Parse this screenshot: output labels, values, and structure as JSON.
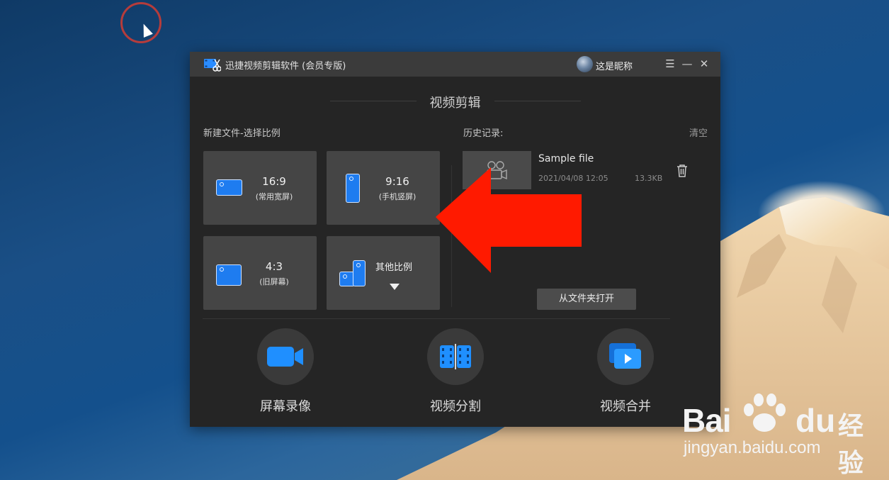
{
  "window": {
    "title": "迅捷视频剪辑软件 (会员专版)",
    "nickname": "这是昵称",
    "menu_glyph": "☰",
    "minimize_glyph": "—",
    "close_glyph": "✕"
  },
  "section_title": "视频剪辑",
  "new_file": {
    "label": "新建文件-选择比例",
    "tiles": [
      {
        "ratio": "16:9",
        "sub": "(常用宽屏)",
        "icon": "landscape-icon"
      },
      {
        "ratio": "9:16",
        "sub": "(手机竖屏)",
        "icon": "portrait-icon"
      },
      {
        "ratio": "4:3",
        "sub": "(旧屏幕)",
        "icon": "standard-icon"
      },
      {
        "ratio": "其他比例",
        "sub": "",
        "icon": "multi-ratio-icon"
      }
    ]
  },
  "history": {
    "label": "历史记录:",
    "clear": "清空",
    "items": [
      {
        "name": "Sample file",
        "date": "2021/04/08 12:05",
        "size": "13.3KB"
      }
    ],
    "open_folder": "从文件夹打开"
  },
  "tools": [
    {
      "label": "屏幕录像",
      "icon": "video-camera-icon"
    },
    {
      "label": "视频分割",
      "icon": "film-split-icon"
    },
    {
      "label": "视频合并",
      "icon": "video-merge-icon"
    }
  ],
  "watermark": {
    "bai": "Bai",
    "du": "du",
    "cn": "经验",
    "url": "jingyan.baidu.com"
  },
  "colors": {
    "accent": "#1e7cf0",
    "arrow": "#ff1a00",
    "window_bg": "#252525",
    "titlebar_bg": "#3b3b3b"
  }
}
